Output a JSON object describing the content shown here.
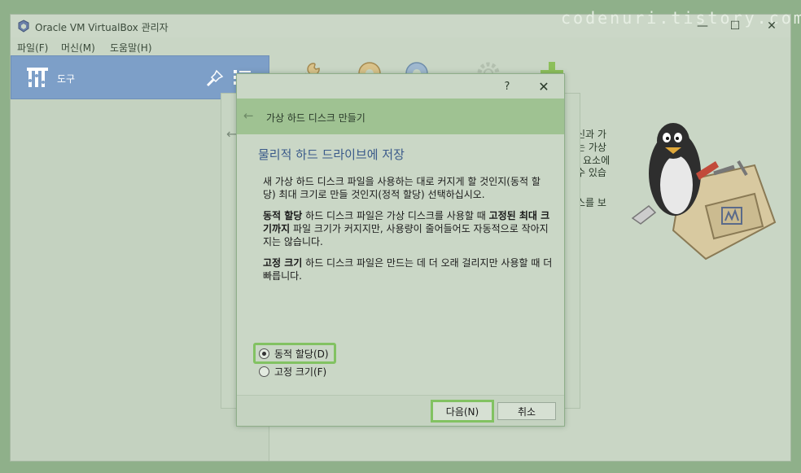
{
  "window": {
    "title": "Oracle VM VirtualBox 관리자",
    "watermark": "codenuri.tistory.com"
  },
  "menubar": {
    "items": [
      "파일(F)",
      "머신(M)",
      "도움말(H)"
    ]
  },
  "sidebar": {
    "tools_label": "도구"
  },
  "welcome": {
    "fragments": [
      "신과 가",
      "는 가상",
      "요소에",
      "수 있습",
      "스를 보"
    ]
  },
  "dialog": {
    "header_title": "가상 하드 디스크 만들기",
    "help": "?",
    "close": "✕",
    "page_title": "물리적 하드 드라이브에 저장",
    "intro": "새 가상 하드 디스크 파일을 사용하는 대로 커지게 할 것인지(동적 할당) 최대 크기로 만들 것인지(정적 할당) 선택하십시오.",
    "dynamic_bold": "동적 할당",
    "dynamic_text1": " 하드 디스크 파일은 가상 디스크를 사용할 때 ",
    "dynamic_bold2": "고정된 최대 크기까지",
    "dynamic_text2": " 파일 크기가 커지지만, 사용량이 줄어들어도 자동적으로 작아지지는 않습니다.",
    "fixed_bold": "고정 크기",
    "fixed_text": " 하드 디스크 파일은 만드는 데 더 오래 걸리지만 사용할 때 더 빠릅니다.",
    "options": [
      {
        "label": "동적 할당(D)",
        "checked": true
      },
      {
        "label": "고정 크기(F)",
        "checked": false
      }
    ],
    "next_label": "다음(N)",
    "cancel_label": "취소"
  },
  "colors": {
    "highlight": "#82c262",
    "header": "#9fc292",
    "selection": "#7d9fc8"
  }
}
